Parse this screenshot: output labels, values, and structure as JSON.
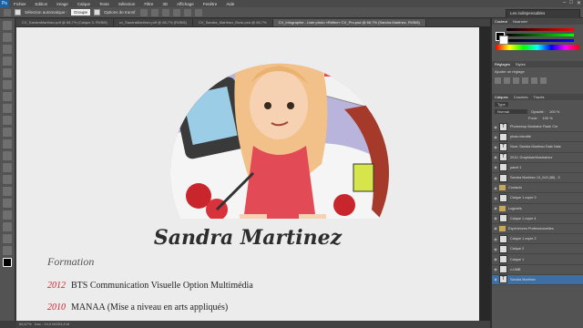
{
  "app": {
    "logo": "Ps"
  },
  "menu": [
    "Fichier",
    "Edition",
    "Image",
    "Calque",
    "Texte",
    "Sélection",
    "Filtre",
    "3D",
    "Affichage",
    "Fenêtre",
    "Aide"
  ],
  "window_controls": [
    "–",
    "□",
    "✕"
  ],
  "options_bar": {
    "auto_select_label": "Sélection automatique :",
    "auto_select_value": "Groupe",
    "transform_label": "Options de transf."
  },
  "workspace": {
    "label": "Les indispensables"
  },
  "tabs": [
    {
      "label": "CV_SandraMartinez.pdf @ 66,7% (Calque 3, RVB/8)",
      "active": false
    },
    {
      "label": "cv_SandraMartinez.pdf @ 66,7% (RVB/8)",
      "active": false
    },
    {
      "label": "CV_Sandra_Martinez_Book.psd @ 66,7%",
      "active": false
    },
    {
      "label": "CV_Infographie - Liste photo «Refine» CV_Pro.psd @ 66,7% (Sandra Martinez, RVB/8)",
      "active": true
    }
  ],
  "document": {
    "name": "Sandra Martinez",
    "section_title": "Formation",
    "entries": [
      {
        "year": "2012",
        "text": "BTS Communication Visuelle Option Multimédia"
      },
      {
        "year": "2010",
        "text": "MANAA (Mise a niveau en arts appliqués)"
      }
    ]
  },
  "status": {
    "zoom": "66,67%",
    "doc": "Doc : 24,9 M/203,8 M"
  },
  "panels": {
    "color_tabs": [
      "Couleur",
      "Nuancier"
    ],
    "adjust_tabs": [
      "Réglages",
      "Styles"
    ],
    "adjust_title": "Ajouter un réglage",
    "layers_tabs": [
      "Calques",
      "Couches",
      "Tracés"
    ],
    "layers_kind": "Type",
    "blend_mode": "Normal",
    "opacity_label": "Opacité :",
    "opacity_value": "100 %",
    "fill_label": "Fond :",
    "fill_value": "100 %"
  },
  "layers": [
    {
      "name": "Photoshop Illustrator Flash Cre",
      "type": "text"
    },
    {
      "name": "photo identité",
      "type": "image"
    },
    {
      "name": "Nom: Sandra Martinez Date Nais",
      "type": "text"
    },
    {
      "name": "2012: Graphiste/Illustratrice",
      "type": "text"
    },
    {
      "name": "panel 1",
      "type": "image"
    },
    {
      "name": "Sandra Martinez 13_0v3 (88) - 3",
      "type": "image"
    },
    {
      "name": "Contacts",
      "type": "folder"
    },
    {
      "name": "Calque 1 copie 3",
      "type": "image"
    },
    {
      "name": "Logiciels",
      "type": "folder"
    },
    {
      "name": "Calque 1 copie 4",
      "type": "image"
    },
    {
      "name": "Expériences Professionnelles",
      "type": "folder"
    },
    {
      "name": "Calque 1 copie 2",
      "type": "image"
    },
    {
      "name": "Calque 2",
      "type": "image"
    },
    {
      "name": "Calque 1",
      "type": "image"
    },
    {
      "name": "c:UMB",
      "type": "image"
    },
    {
      "name": "Sandra Martinez",
      "type": "text",
      "selected": true
    }
  ],
  "colors": {
    "accent_year": "#d0202a",
    "selected_layer": "#3d6fa5",
    "app_dark": "#535353"
  }
}
